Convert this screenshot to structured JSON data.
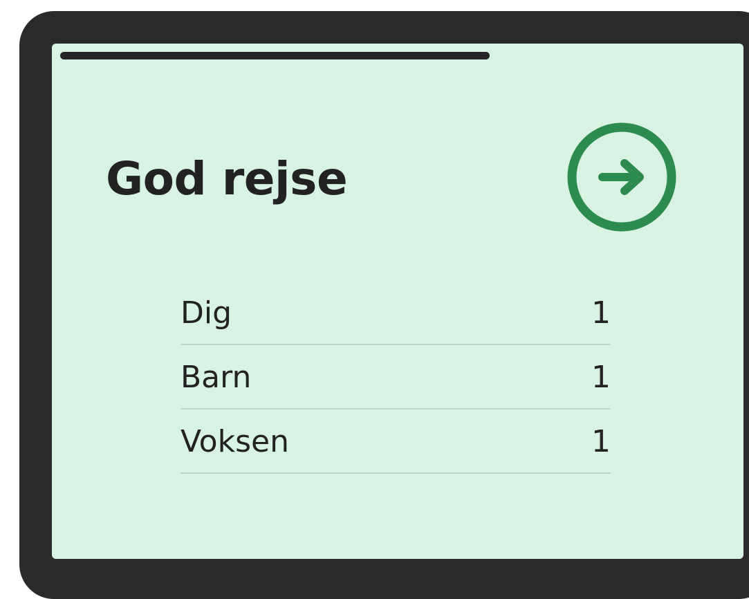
{
  "progress": {
    "fraction": 0.69
  },
  "title": "God rejse",
  "next_button": {
    "icon": "arrow-right-icon",
    "accent_color": "#2e8b4f"
  },
  "passengers": [
    {
      "label": "Dig",
      "count": "1"
    },
    {
      "label": "Barn",
      "count": "1"
    },
    {
      "label": "Voksen",
      "count": "1"
    }
  ],
  "colors": {
    "frame": "#2a2a2a",
    "screen_background": "#d8f3e4",
    "divider": "#b7d9c5",
    "text": "#222222"
  }
}
